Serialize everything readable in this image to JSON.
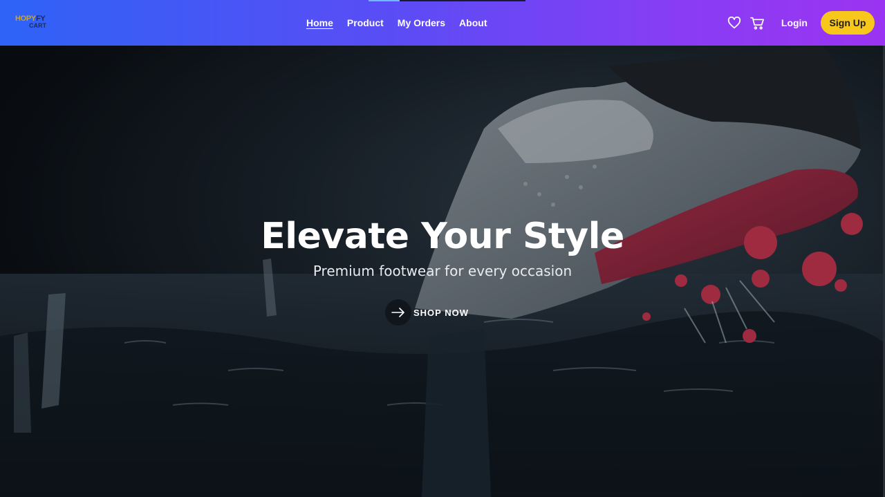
{
  "brand": {
    "logo_top_a": "HOPY",
    "logo_top_b": "FY",
    "logo_bottom": "CART"
  },
  "nav": {
    "links": [
      {
        "label": "Home",
        "active": true
      },
      {
        "label": "Product",
        "active": false
      },
      {
        "label": "My Orders",
        "active": false
      },
      {
        "label": "About",
        "active": false
      }
    ],
    "wishlist_icon": "heart-icon",
    "cart_icon": "cart-icon",
    "login_label": "Login",
    "signup_label": "Sign Up"
  },
  "hero": {
    "title": "Elevate Your Style",
    "subtitle": "Premium footwear for every occasion",
    "cta_label": "SHOP NOW",
    "cta_icon": "arrow-right-icon"
  },
  "colors": {
    "nav_gradient_start": "#2e63f7",
    "nav_gradient_end": "#9b34f2",
    "signup_bg": "#f7c71c",
    "hero_text": "#ffffff"
  }
}
